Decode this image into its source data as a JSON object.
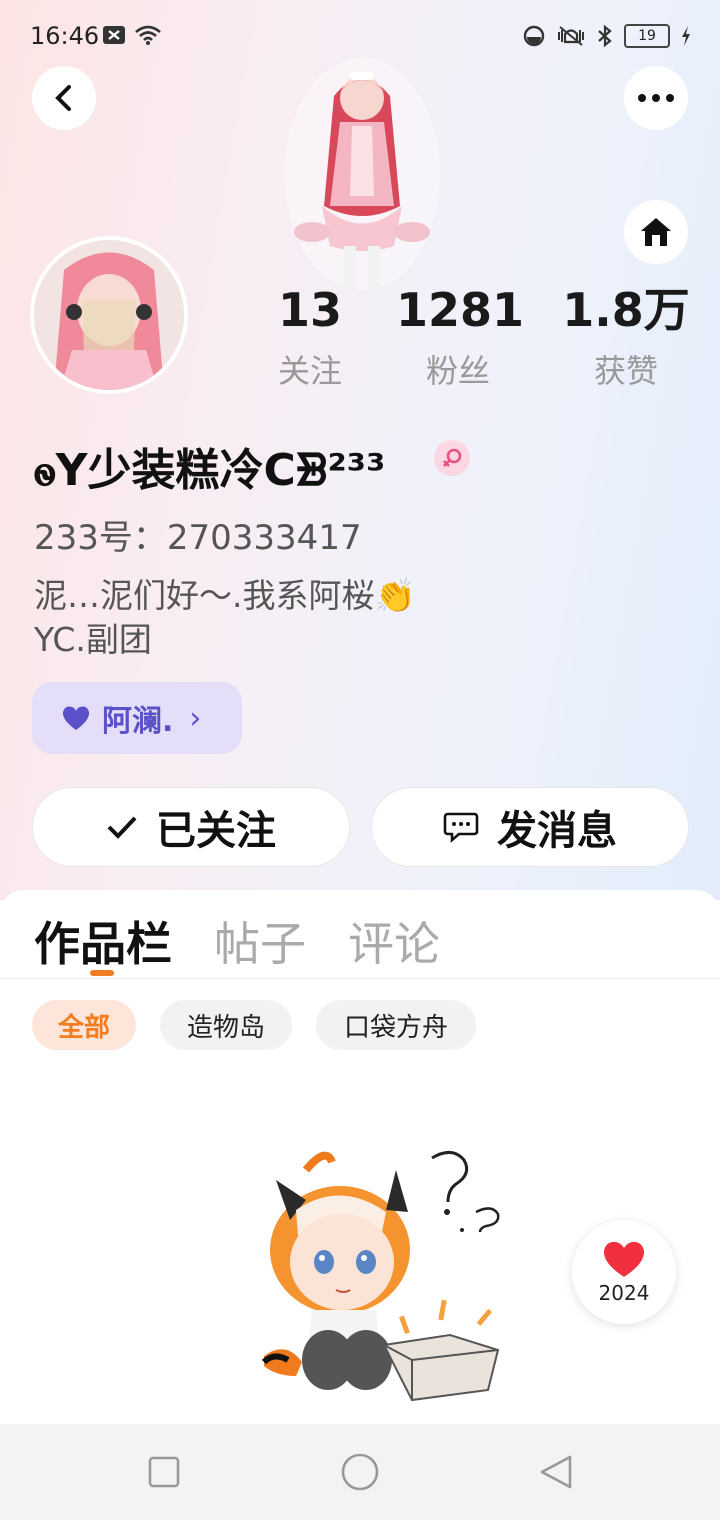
{
  "status_bar": {
    "time": "16:46",
    "battery": "19"
  },
  "profile": {
    "stats": [
      {
        "num": "13",
        "label": "关注"
      },
      {
        "num": "1281",
        "label": "粉丝"
      },
      {
        "num": "1.8万",
        "label": "获赞"
      }
    ],
    "username": "ꮻY少装糕冷Cᗾ²³³",
    "uid": "233号：270333417",
    "bio": "泥…泥们好～.我系阿桜👏\nYC.副团",
    "fan_club": "阿澜.",
    "fan_club_chevron": "›"
  },
  "actions": {
    "follow": "已关注",
    "message": "发消息"
  },
  "tabs": [
    "作品栏",
    "帖子",
    "评论"
  ],
  "filters": [
    "全部",
    "造物岛",
    "口袋方舟"
  ],
  "float_badge": {
    "year": "2024"
  },
  "colors": {
    "accent": "#f47c20",
    "fan_purple": "#5b51c8",
    "heart_red": "#f0303e"
  }
}
